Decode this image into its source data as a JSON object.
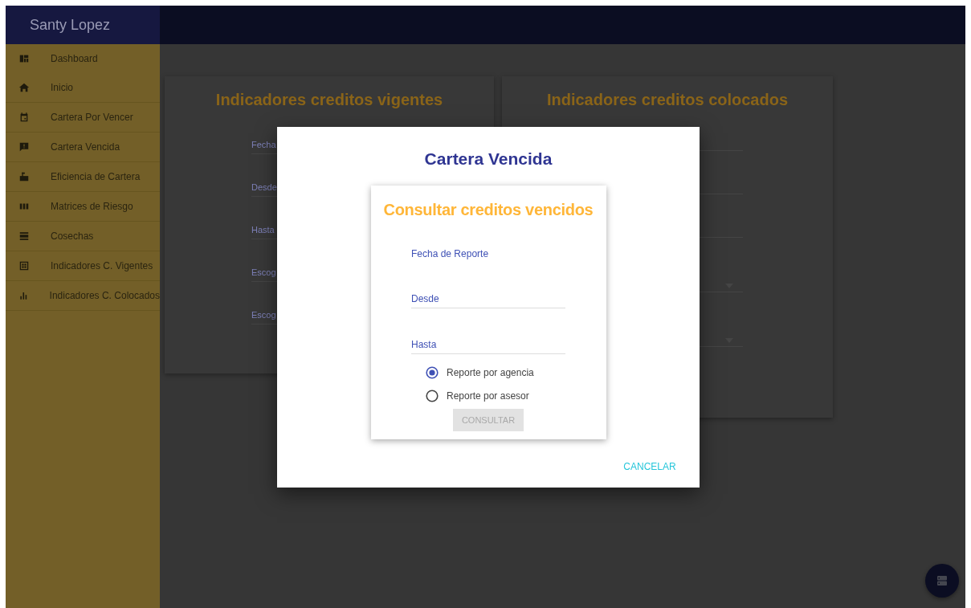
{
  "header": {
    "user_name": "Santy Lopez"
  },
  "sidebar": {
    "items": [
      {
        "label": "Dashboard"
      },
      {
        "label": "Inicio"
      },
      {
        "label": "Cartera Por Vencer"
      },
      {
        "label": "Cartera Vencida"
      },
      {
        "label": "Eficiencia de Cartera"
      },
      {
        "label": "Matrices de Riesgo"
      },
      {
        "label": "Cosechas"
      },
      {
        "label": "Indicadores C. Vigentes"
      },
      {
        "label": "Indicadores C. Colocados"
      }
    ]
  },
  "cards": [
    {
      "title": "Indicadores creditos vigentes",
      "fields": [
        "Fecha",
        "Desde",
        "Hasta",
        "Escog",
        "Escog"
      ]
    },
    {
      "title": "Indicadores creditos colocados"
    }
  ],
  "dialog": {
    "title": "Cartera Vencida",
    "form": {
      "title": "Consultar creditos vencidos",
      "report_date_label": "Fecha de Reporte",
      "fields": [
        "Desde",
        "Hasta"
      ],
      "radios": [
        {
          "label": "Reporte por agencia",
          "selected": true
        },
        {
          "label": "Reporte por asesor",
          "selected": false
        }
      ],
      "submit": {
        "label": "CONSULTAR",
        "disabled": true
      }
    },
    "actions": [
      "CANCELAR"
    ]
  }
}
